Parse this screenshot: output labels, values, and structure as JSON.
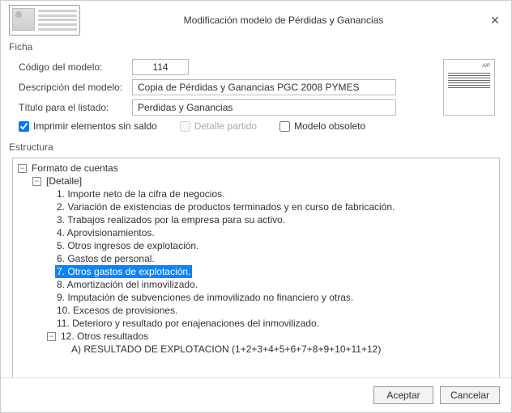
{
  "window": {
    "title": "Modificación  modelo de Pérdidas y Ganancias"
  },
  "sections": {
    "ficha": "Ficha",
    "estructura": "Estructura"
  },
  "fields": {
    "codigo_label": "Código del modelo:",
    "codigo_value": "114",
    "descripcion_label": "Descripción del modelo:",
    "descripcion_value": "Copia de Pérdidas y Ganancias PGC 2008 PYMES",
    "titulo_label": "Título para el listado:",
    "titulo_value": "Perdidas y Ganancias"
  },
  "thumb_label": "A/P",
  "checks": {
    "imprimir": "Imprimir elementos sin saldo",
    "detalle": "Detalle partido",
    "obsoleto": "Modelo obsoleto"
  },
  "tree": [
    {
      "indent": 0,
      "toggle": "−",
      "label": "Formato de cuentas",
      "selected": false
    },
    {
      "indent": 1,
      "toggle": "−",
      "label": "[Detalle]",
      "selected": false
    },
    {
      "indent": 2,
      "toggle": "",
      "label": "1. Importe neto de la cifra de negocios.",
      "selected": false
    },
    {
      "indent": 2,
      "toggle": "",
      "label": "2. Variación de existencias de productos terminados y en curso de fabricación.",
      "selected": false
    },
    {
      "indent": 2,
      "toggle": "",
      "label": "3. Trabajos realizados por la empresa para su activo.",
      "selected": false
    },
    {
      "indent": 2,
      "toggle": "",
      "label": "4. Aprovisionamientos.",
      "selected": false
    },
    {
      "indent": 2,
      "toggle": "",
      "label": "5. Otros ingresos de explotación.",
      "selected": false
    },
    {
      "indent": 2,
      "toggle": "",
      "label": "6. Gastos de personal.",
      "selected": false
    },
    {
      "indent": 2,
      "toggle": "",
      "label": "7. Otros gastos de explotación.",
      "selected": true
    },
    {
      "indent": 2,
      "toggle": "",
      "label": "8. Amortización del inmovilizado.",
      "selected": false
    },
    {
      "indent": 2,
      "toggle": "",
      "label": "9. Imputación de subvenciones de inmovilizado no financiero y otras.",
      "selected": false
    },
    {
      "indent": 2,
      "toggle": "",
      "label": "10. Excesos de provisiones.",
      "selected": false
    },
    {
      "indent": 2,
      "toggle": "",
      "label": "11. Deterioro y resultado por enajenaciones del inmovilizado.",
      "selected": false
    },
    {
      "indent": 2,
      "toggle": "−",
      "label": "12. Otros resultados",
      "selected": false
    },
    {
      "indent": 3,
      "toggle": "",
      "label": "A) RESULTADO DE EXPLOTACION (1+2+3+4+5+6+7+8+9+10+11+12)",
      "selected": false
    }
  ],
  "buttons": {
    "ok": "Aceptar",
    "cancel": "Cancelar"
  }
}
